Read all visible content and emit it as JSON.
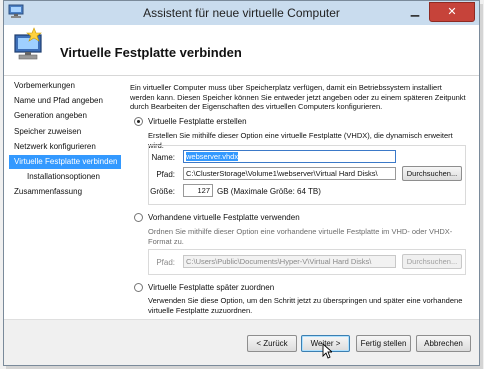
{
  "window": {
    "title": "Assistent für neue virtuelle Computer",
    "minimize_glyph": "▁",
    "close_glyph": "✕"
  },
  "header": {
    "title": "Virtuelle Festplatte verbinden"
  },
  "sidebar": {
    "items": [
      {
        "label": "Vorbemerkungen"
      },
      {
        "label": "Name und Pfad angeben"
      },
      {
        "label": "Generation angeben"
      },
      {
        "label": "Speicher zuweisen"
      },
      {
        "label": "Netzwerk konfigurieren"
      },
      {
        "label": "Virtuelle Festplatte verbinden"
      },
      {
        "label": "Installationsoptionen"
      },
      {
        "label": "Zusammenfassung"
      }
    ]
  },
  "content": {
    "intro": "Ein virtueller Computer muss über Speicherplatz verfügen, damit ein Betriebssystem installiert werden kann. Diesen Speicher können Sie entweder jetzt angeben oder zu einem späteren Zeitpunkt durch Bearbeiten der Eigenschaften des virtuellen Computers konfigurieren.",
    "option_create": {
      "label": "Virtuelle Festplatte erstellen",
      "selected": true,
      "description": "Erstellen Sie mithilfe dieser Option eine virtuelle Festplatte (VHDX), die dynamisch erweitert wird.",
      "name_label": "Name:",
      "name_value": "webserver.vhdx",
      "path_label": "Pfad:",
      "path_value": "C:\\ClusterStorage\\Volume1\\webserver\\Virtual Hard Disks\\",
      "browse_label": "Durchsuchen...",
      "size_label": "Größe:",
      "size_value": "127",
      "size_unit": "GB (Maximale Größe: 64 TB)"
    },
    "option_existing": {
      "label": "Vorhandene virtuelle Festplatte verwenden",
      "selected": false,
      "description": "Ordnen Sie mithilfe dieser Option eine vorhandene virtuelle Festplatte im VHD- oder VHDX-Format zu.",
      "path_label": "Pfad:",
      "path_value": "C:\\Users\\Public\\Documents\\Hyper-V\\Virtual Hard Disks\\",
      "browse_label": "Durchsuchen..."
    },
    "option_later": {
      "label": "Virtuelle Festplatte später zuordnen",
      "selected": false,
      "description": "Verwenden Sie diese Option, um den Schritt jetzt zu überspringen und später eine vorhandene virtuelle Festplatte zuzuordnen."
    }
  },
  "footer": {
    "back_label": "< Zurück",
    "next_label": "Weiter >",
    "finish_label": "Fertig stellen",
    "cancel_label": "Abbrechen"
  },
  "colors": {
    "selection": "#3399ff",
    "titlebar": "#c9dcee",
    "close_button": "#c6433a"
  },
  "icons": {
    "app": "virtual-machine-icon",
    "header": "virtual-machine-wizard-icon",
    "cursor": "mouse-pointer-icon"
  }
}
